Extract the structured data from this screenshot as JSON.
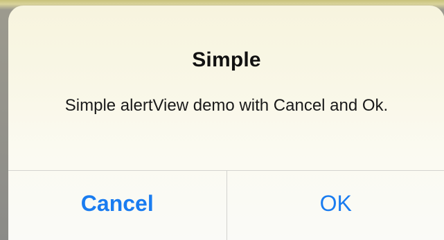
{
  "alert": {
    "title": "Simple",
    "message": "Simple alertView demo with Cancel and Ok.",
    "buttons": {
      "cancel_label": "Cancel",
      "ok_label": "OK"
    },
    "colors": {
      "button_text": "#1a7cf0",
      "background": "#f9f7e7",
      "divider": "#d3d3cf"
    }
  }
}
